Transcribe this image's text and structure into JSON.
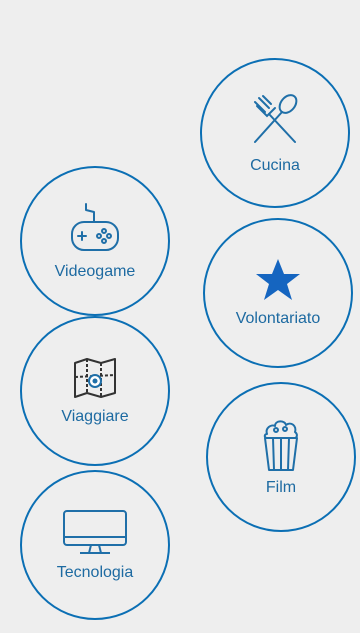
{
  "interests": [
    {
      "id": "cucina",
      "label": "Cucina",
      "icon": "fork-spoon-icon"
    },
    {
      "id": "videogame",
      "label": "Videogame",
      "icon": "gamepad-icon"
    },
    {
      "id": "volontariato",
      "label": "Volontariato",
      "icon": "star-icon"
    },
    {
      "id": "viaggiare",
      "label": "Viaggiare",
      "icon": "map-pin-icon"
    },
    {
      "id": "film",
      "label": "Film",
      "icon": "popcorn-icon"
    },
    {
      "id": "tecnologia",
      "label": "Tecnologia",
      "icon": "monitor-icon"
    }
  ],
  "colors": {
    "background": "#eeeeee",
    "accent": "#0b6fb4",
    "label": "#1d6aa1"
  }
}
